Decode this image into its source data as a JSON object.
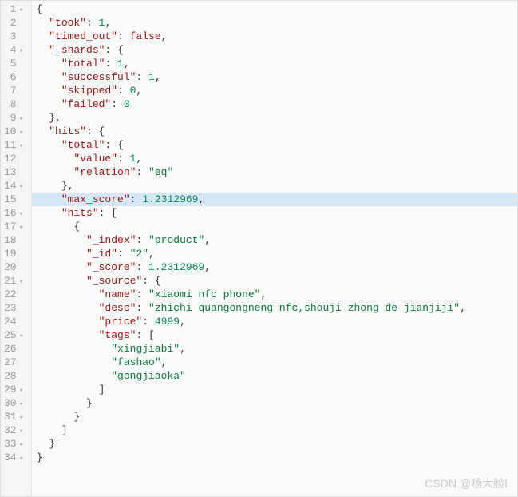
{
  "highlighted_line": 15,
  "lines": [
    {
      "n": 1,
      "fold": true,
      "indent": 0,
      "tokens": [
        [
          "punc",
          "{"
        ]
      ]
    },
    {
      "n": 2,
      "fold": false,
      "indent": 1,
      "tokens": [
        [
          "key",
          "\"took\""
        ],
        [
          "colon",
          ": "
        ],
        [
          "num",
          "1"
        ],
        [
          "punc",
          ","
        ]
      ]
    },
    {
      "n": 3,
      "fold": false,
      "indent": 1,
      "tokens": [
        [
          "key",
          "\"timed_out\""
        ],
        [
          "colon",
          ": "
        ],
        [
          "bool",
          "false"
        ],
        [
          "punc",
          ","
        ]
      ]
    },
    {
      "n": 4,
      "fold": true,
      "indent": 1,
      "tokens": [
        [
          "key",
          "\"_shards\""
        ],
        [
          "colon",
          ": "
        ],
        [
          "punc",
          "{"
        ]
      ]
    },
    {
      "n": 5,
      "fold": false,
      "indent": 2,
      "tokens": [
        [
          "key",
          "\"total\""
        ],
        [
          "colon",
          ": "
        ],
        [
          "num",
          "1"
        ],
        [
          "punc",
          ","
        ]
      ]
    },
    {
      "n": 6,
      "fold": false,
      "indent": 2,
      "tokens": [
        [
          "key",
          "\"successful\""
        ],
        [
          "colon",
          ": "
        ],
        [
          "num",
          "1"
        ],
        [
          "punc",
          ","
        ]
      ]
    },
    {
      "n": 7,
      "fold": false,
      "indent": 2,
      "tokens": [
        [
          "key",
          "\"skipped\""
        ],
        [
          "colon",
          ": "
        ],
        [
          "num",
          "0"
        ],
        [
          "punc",
          ","
        ]
      ]
    },
    {
      "n": 8,
      "fold": false,
      "indent": 2,
      "tokens": [
        [
          "key",
          "\"failed\""
        ],
        [
          "colon",
          ": "
        ],
        [
          "num",
          "0"
        ]
      ]
    },
    {
      "n": 9,
      "fold": true,
      "indent": 1,
      "tokens": [
        [
          "punc",
          "},"
        ]
      ]
    },
    {
      "n": 10,
      "fold": true,
      "indent": 1,
      "tokens": [
        [
          "key",
          "\"hits\""
        ],
        [
          "colon",
          ": "
        ],
        [
          "punc",
          "{"
        ]
      ]
    },
    {
      "n": 11,
      "fold": true,
      "indent": 2,
      "tokens": [
        [
          "key",
          "\"total\""
        ],
        [
          "colon",
          ": "
        ],
        [
          "punc",
          "{"
        ]
      ]
    },
    {
      "n": 12,
      "fold": false,
      "indent": 3,
      "tokens": [
        [
          "key",
          "\"value\""
        ],
        [
          "colon",
          ": "
        ],
        [
          "num",
          "1"
        ],
        [
          "punc",
          ","
        ]
      ]
    },
    {
      "n": 13,
      "fold": false,
      "indent": 3,
      "tokens": [
        [
          "key",
          "\"relation\""
        ],
        [
          "colon",
          ": "
        ],
        [
          "str",
          "\"eq\""
        ]
      ]
    },
    {
      "n": 14,
      "fold": true,
      "indent": 2,
      "tokens": [
        [
          "punc",
          "},"
        ]
      ]
    },
    {
      "n": 15,
      "fold": false,
      "indent": 2,
      "tokens": [
        [
          "key",
          "\"max_score\""
        ],
        [
          "colon",
          ": "
        ],
        [
          "num",
          "1.2312969"
        ],
        [
          "punc",
          ","
        ],
        [
          "cursor",
          ""
        ]
      ]
    },
    {
      "n": 16,
      "fold": true,
      "indent": 2,
      "tokens": [
        [
          "key",
          "\"hits\""
        ],
        [
          "colon",
          ": "
        ],
        [
          "punc",
          "["
        ]
      ]
    },
    {
      "n": 17,
      "fold": true,
      "indent": 3,
      "tokens": [
        [
          "punc",
          "{"
        ]
      ]
    },
    {
      "n": 18,
      "fold": false,
      "indent": 4,
      "tokens": [
        [
          "key",
          "\"_index\""
        ],
        [
          "colon",
          ": "
        ],
        [
          "str",
          "\"product\""
        ],
        [
          "punc",
          ","
        ]
      ]
    },
    {
      "n": 19,
      "fold": false,
      "indent": 4,
      "tokens": [
        [
          "key",
          "\"_id\""
        ],
        [
          "colon",
          ": "
        ],
        [
          "str",
          "\"2\""
        ],
        [
          "punc",
          ","
        ]
      ]
    },
    {
      "n": 20,
      "fold": false,
      "indent": 4,
      "tokens": [
        [
          "key",
          "\"_score\""
        ],
        [
          "colon",
          ": "
        ],
        [
          "num",
          "1.2312969"
        ],
        [
          "punc",
          ","
        ]
      ]
    },
    {
      "n": 21,
      "fold": true,
      "indent": 4,
      "tokens": [
        [
          "key",
          "\"_source\""
        ],
        [
          "colon",
          ": "
        ],
        [
          "punc",
          "{"
        ]
      ]
    },
    {
      "n": 22,
      "fold": false,
      "indent": 5,
      "tokens": [
        [
          "key",
          "\"name\""
        ],
        [
          "colon",
          ": "
        ],
        [
          "str",
          "\"xiaomi nfc phone\""
        ],
        [
          "punc",
          ","
        ]
      ]
    },
    {
      "n": 23,
      "fold": false,
      "indent": 5,
      "tokens": [
        [
          "key",
          "\"desc\""
        ],
        [
          "colon",
          ": "
        ],
        [
          "str",
          "\"zhichi quangongneng nfc,shouji zhong de jianjiji\""
        ],
        [
          "punc",
          ","
        ]
      ]
    },
    {
      "n": 24,
      "fold": false,
      "indent": 5,
      "tokens": [
        [
          "key",
          "\"price\""
        ],
        [
          "colon",
          ": "
        ],
        [
          "num",
          "4999"
        ],
        [
          "punc",
          ","
        ]
      ]
    },
    {
      "n": 25,
      "fold": true,
      "indent": 5,
      "tokens": [
        [
          "key",
          "\"tags\""
        ],
        [
          "colon",
          ": "
        ],
        [
          "punc",
          "["
        ]
      ]
    },
    {
      "n": 26,
      "fold": false,
      "indent": 6,
      "tokens": [
        [
          "str",
          "\"xingjiabi\""
        ],
        [
          "punc",
          ","
        ]
      ]
    },
    {
      "n": 27,
      "fold": false,
      "indent": 6,
      "tokens": [
        [
          "str",
          "\"fashao\""
        ],
        [
          "punc",
          ","
        ]
      ]
    },
    {
      "n": 28,
      "fold": false,
      "indent": 6,
      "tokens": [
        [
          "str",
          "\"gongjiaoka\""
        ]
      ]
    },
    {
      "n": 29,
      "fold": true,
      "indent": 5,
      "tokens": [
        [
          "punc",
          "]"
        ]
      ]
    },
    {
      "n": 30,
      "fold": true,
      "indent": 4,
      "tokens": [
        [
          "punc",
          "}"
        ]
      ]
    },
    {
      "n": 31,
      "fold": true,
      "indent": 3,
      "tokens": [
        [
          "punc",
          "}"
        ]
      ]
    },
    {
      "n": 32,
      "fold": true,
      "indent": 2,
      "tokens": [
        [
          "punc",
          "]"
        ]
      ]
    },
    {
      "n": 33,
      "fold": true,
      "indent": 1,
      "tokens": [
        [
          "punc",
          "}"
        ]
      ]
    },
    {
      "n": 34,
      "fold": true,
      "indent": 0,
      "tokens": [
        [
          "punc",
          "}"
        ]
      ]
    }
  ],
  "watermark": "CSDN @杨大脸I",
  "fold_symbol": "▾"
}
